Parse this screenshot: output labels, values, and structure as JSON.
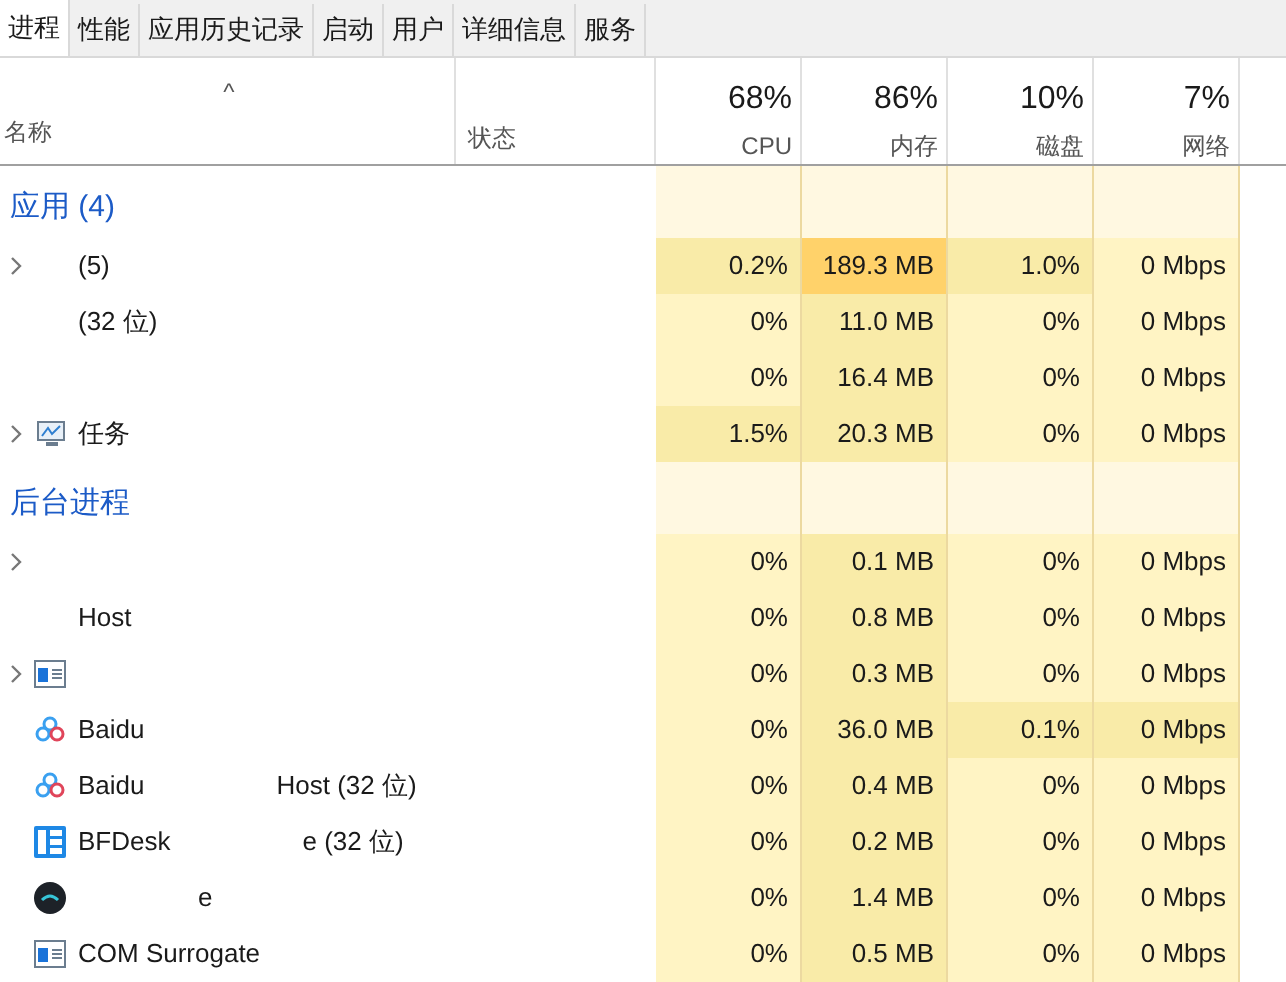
{
  "tabs": [
    {
      "label": "进程",
      "selected": true
    },
    {
      "label": "性能",
      "selected": false
    },
    {
      "label": "应用历史记录",
      "selected": false
    },
    {
      "label": "启动",
      "selected": false
    },
    {
      "label": "用户",
      "selected": false
    },
    {
      "label": "详细信息",
      "selected": false
    },
    {
      "label": "服务",
      "selected": false
    }
  ],
  "header": {
    "sort_caret": "^",
    "name": "名称",
    "status": "状态",
    "columns": [
      {
        "percent": "68%",
        "label": "CPU"
      },
      {
        "percent": "86%",
        "label": "内存"
      },
      {
        "percent": "10%",
        "label": "磁盘"
      },
      {
        "percent": "7%",
        "label": "网络"
      }
    ]
  },
  "groups": [
    {
      "title": "应用 (4)",
      "rows": [
        {
          "name": "(5)",
          "kind": "plain",
          "expandable": true,
          "cells": [
            {
              "text": "0.2%",
              "color": "#f9eba8"
            },
            {
              "text": "189.3 MB",
              "color": "#ffd26a"
            },
            {
              "text": "1.0%",
              "color": "#f9eba8"
            },
            {
              "text": "0 Mbps",
              "color": "#fff4c4"
            }
          ]
        },
        {
          "name": "(32 位)",
          "kind": "plain",
          "expandable": false,
          "cells": [
            {
              "text": "0%",
              "color": "#fff4c4"
            },
            {
              "text": "11.0 MB",
              "color": "#f9eba8"
            },
            {
              "text": "0%",
              "color": "#fff4c4"
            },
            {
              "text": "0 Mbps",
              "color": "#fff4c4"
            }
          ]
        },
        {
          "kind": "plain",
          "expandable": false,
          "cells": [
            {
              "text": "0%",
              "color": "#fff4c4"
            },
            {
              "text": "16.4 MB",
              "color": "#f9eba8"
            },
            {
              "text": "0%",
              "color": "#fff4c4"
            },
            {
              "text": "0 Mbps",
              "color": "#fff4c4"
            }
          ]
        },
        {
          "name": "任务",
          "kind": "monitor",
          "expandable": true,
          "cells": [
            {
              "text": "1.5%",
              "color": "#f9eba8"
            },
            {
              "text": "20.3 MB",
              "color": "#f9eba8"
            },
            {
              "text": "0%",
              "color": "#fff4c4"
            },
            {
              "text": "0 Mbps",
              "color": "#fff4c4"
            }
          ]
        }
      ]
    },
    {
      "title": "后台进程",
      "rows": [
        {
          "kind": "plain",
          "expandable": true,
          "cells": [
            {
              "text": "0%",
              "color": "#fff4c4"
            },
            {
              "text": "0.1 MB",
              "color": "#f9eba8"
            },
            {
              "text": "0%",
              "color": "#fff4c4"
            },
            {
              "text": "0 Mbps",
              "color": "#fff4c4"
            }
          ]
        },
        {
          "name": "Host",
          "kind": "plain",
          "expandable": false,
          "cells": [
            {
              "text": "0%",
              "color": "#fff4c4"
            },
            {
              "text": "0.8 MB",
              "color": "#f9eba8"
            },
            {
              "text": "0%",
              "color": "#fff4c4"
            },
            {
              "text": "0 Mbps",
              "color": "#fff4c4"
            }
          ]
        },
        {
          "kind": "window",
          "expandable": true,
          "cells": [
            {
              "text": "0%",
              "color": "#fff4c4"
            },
            {
              "text": "0.3 MB",
              "color": "#f9eba8"
            },
            {
              "text": "0%",
              "color": "#fff4c4"
            },
            {
              "text": "0 Mbps",
              "color": "#fff4c4"
            }
          ]
        },
        {
          "name": "Baidu",
          "kind": "cloud",
          "expandable": false,
          "cells": [
            {
              "text": "0%",
              "color": "#fff4c4"
            },
            {
              "text": "36.0 MB",
              "color": "#f9eba8"
            },
            {
              "text": "0.1%",
              "color": "#f9eba8"
            },
            {
              "text": "0 Mbps",
              "color": "#f9eba8"
            }
          ]
        },
        {
          "name": "Baidu",
          "name_tail": "Host (32 位)",
          "kind": "cloud",
          "expandable": false,
          "cells": [
            {
              "text": "0%",
              "color": "#fff4c4"
            },
            {
              "text": "0.4 MB",
              "color": "#f9eba8"
            },
            {
              "text": "0%",
              "color": "#fff4c4"
            },
            {
              "text": "0 Mbps",
              "color": "#fff4c4"
            }
          ]
        },
        {
          "name": "BFDesk",
          "name_tail": "e (32 位)",
          "kind": "grid",
          "expandable": false,
          "cells": [
            {
              "text": "0%",
              "color": "#fff4c4"
            },
            {
              "text": "0.2 MB",
              "color": "#f9eba8"
            },
            {
              "text": "0%",
              "color": "#fff4c4"
            },
            {
              "text": "0 Mbps",
              "color": "#fff4c4"
            }
          ]
        },
        {
          "name_tail": "e",
          "kind": "dark",
          "expandable": false,
          "cells": [
            {
              "text": "0%",
              "color": "#fff4c4"
            },
            {
              "text": "1.4 MB",
              "color": "#f9eba8"
            },
            {
              "text": "0%",
              "color": "#fff4c4"
            },
            {
              "text": "0 Mbps",
              "color": "#fff4c4"
            }
          ]
        },
        {
          "name": "COM Surrogate",
          "kind": "window",
          "expandable": false,
          "cells": [
            {
              "text": "0%",
              "color": "#fff4c4"
            },
            {
              "text": "0.5 MB",
              "color": "#f9eba8"
            },
            {
              "text": "0%",
              "color": "#fff4c4"
            },
            {
              "text": "0 Mbps",
              "color": "#fff4c4"
            }
          ]
        }
      ]
    }
  ]
}
